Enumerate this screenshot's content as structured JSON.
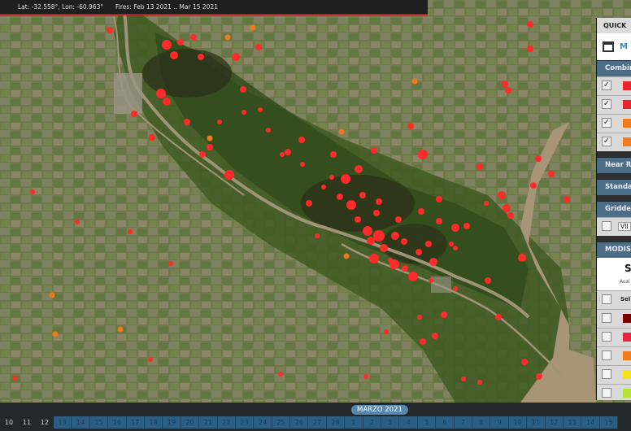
{
  "header": {
    "coords": "Lat: -32.558°, Lon: -60.963°",
    "fires_range": "Fires: Feb 13 2021 .. Mar 15 2021"
  },
  "panel": {
    "title": "QUICK",
    "tab_label": "M",
    "combined_label": "Combin",
    "combined_colors": [
      "#e8252a",
      "#e8252a",
      "#f07a1c",
      "#f07a1c"
    ],
    "near_label": "Near R",
    "standard_label": "Standa",
    "gridded_label": "Gridde",
    "gridded_value": "VII",
    "modis_label": "MODIS",
    "swatch_title": "S",
    "swatch_sub": "Avai",
    "select_label": "Sel",
    "modis_colors": [
      "#7a0000",
      "#e8253f",
      "#f07a1c",
      "#f7e21a",
      "#b8e23a",
      "#46c24a"
    ]
  },
  "timeline": {
    "month": "MARZO 2021",
    "pre_days": [
      "10",
      "11",
      "12"
    ],
    "feb_days": [
      "13",
      "14",
      "15",
      "16",
      "17",
      "18",
      "19",
      "20",
      "21",
      "22",
      "23",
      "24",
      "25",
      "26",
      "27",
      "28"
    ],
    "mar_days": [
      "1",
      "2",
      "3",
      "4",
      "5",
      "6",
      "7",
      "8",
      "9",
      "10",
      "11",
      "12",
      "13",
      "14",
      "15"
    ]
  },
  "map": {
    "fire_color": "#ff2a2a",
    "low_fire_color": "#f07a1c"
  }
}
